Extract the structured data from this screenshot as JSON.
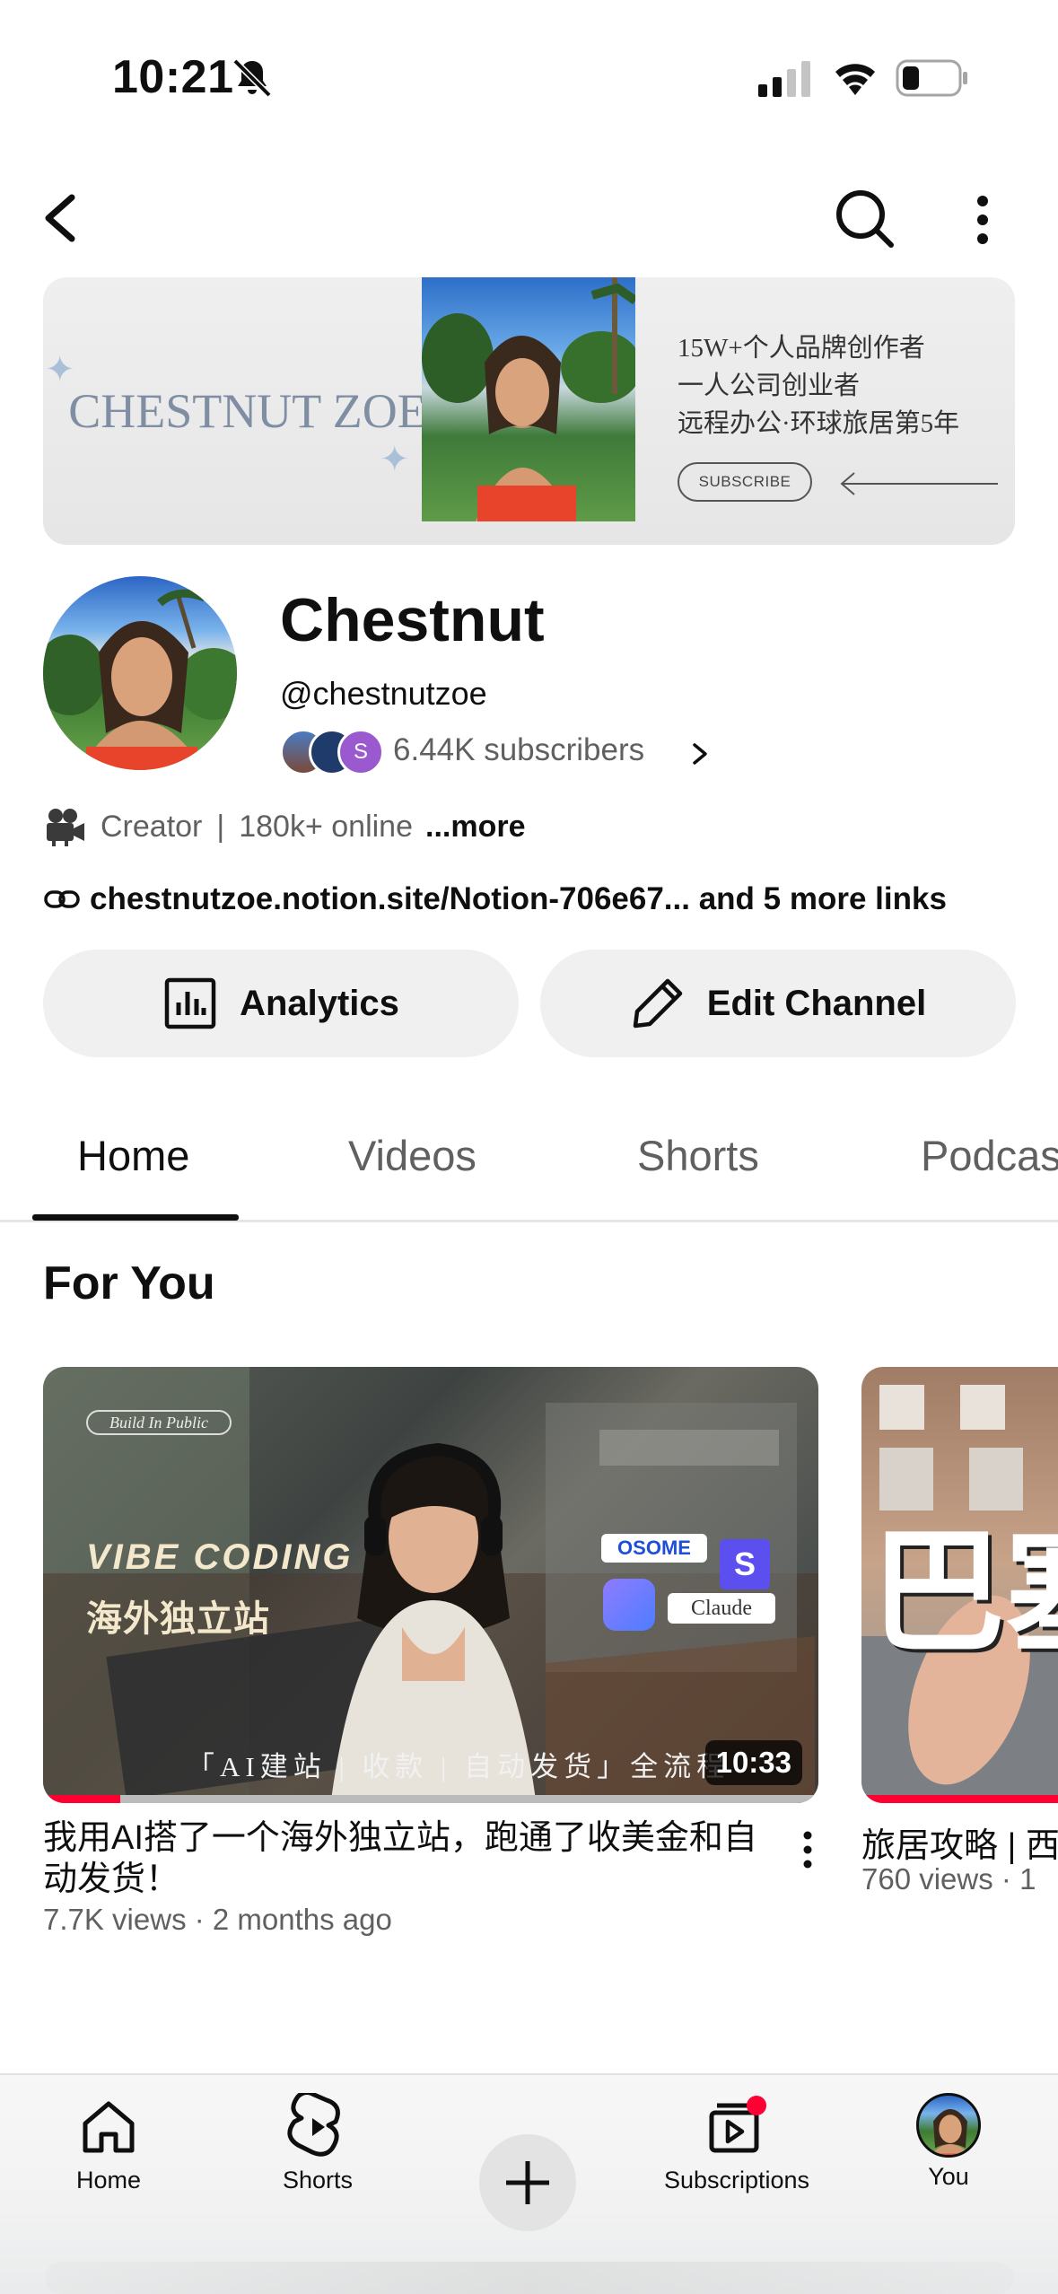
{
  "status_bar": {
    "time": "10:21",
    "icons": [
      "bell-off-icon",
      "cellular-signal-icon",
      "wifi-icon",
      "battery-icon"
    ]
  },
  "header": {
    "icons": [
      "back-arrow-icon",
      "search-icon",
      "more-vertical-icon"
    ]
  },
  "banner": {
    "brand": "CHESTNUT ZOE",
    "lines": [
      "15W+个人品牌创作者",
      "一人公司创业者",
      "远程办公·环球旅居第5年"
    ],
    "subscribe_label": "SUBSCRIBE"
  },
  "channel": {
    "name": "Chestnut",
    "handle": "@chestnutzoe",
    "subscribers": "6.44K subscribers",
    "meta_role": "Creator",
    "meta_separator": "|",
    "meta_online": "180k+ online",
    "meta_more": "...more",
    "links": "chestnutzoe.notion.site/Notion-706e67... and 5 more links",
    "subscriber_avatar_letter": "S"
  },
  "actions": {
    "analytics_label": "Analytics",
    "edit_label": "Edit Channel"
  },
  "tabs": [
    {
      "label": "Home",
      "active": true
    },
    {
      "label": "Videos",
      "active": false
    },
    {
      "label": "Shorts",
      "active": false
    },
    {
      "label": "Podcasts",
      "active": false
    }
  ],
  "section": {
    "title": "For You"
  },
  "videos": [
    {
      "title": "我用AI搭了一个海外独立站，跑通了收美金和自动发货！",
      "meta": "7.7K views · 2 months ago",
      "duration": "10:33",
      "watched_fraction": 0.1,
      "thumb_badge": "Build In Public",
      "thumb_headline": "VIBE CODING",
      "thumb_subheadline": "海外独立站",
      "thumb_caption": "「AI建站 | 收款 | 自动发货」全流程",
      "thumb_logos": [
        "OSOME",
        "S",
        "Claude"
      ]
    },
    {
      "title": "旅居攻略 | 西",
      "meta": "760 views · 1",
      "thumb_text": "巴塞",
      "watched_fraction": 1.0
    }
  ],
  "bottom_nav": [
    {
      "label": "Home",
      "icon": "home-icon"
    },
    {
      "label": "Shorts",
      "icon": "shorts-icon"
    },
    {
      "label": "",
      "icon": "create-plus-icon"
    },
    {
      "label": "Subscriptions",
      "icon": "subscriptions-icon"
    },
    {
      "label": "You",
      "icon": "profile-avatar-icon"
    }
  ],
  "colors": {
    "accent_red": "#ff0033",
    "text_primary": "#0f0f0f",
    "text_secondary": "#606060",
    "chip_bg": "#f0f0f0"
  }
}
